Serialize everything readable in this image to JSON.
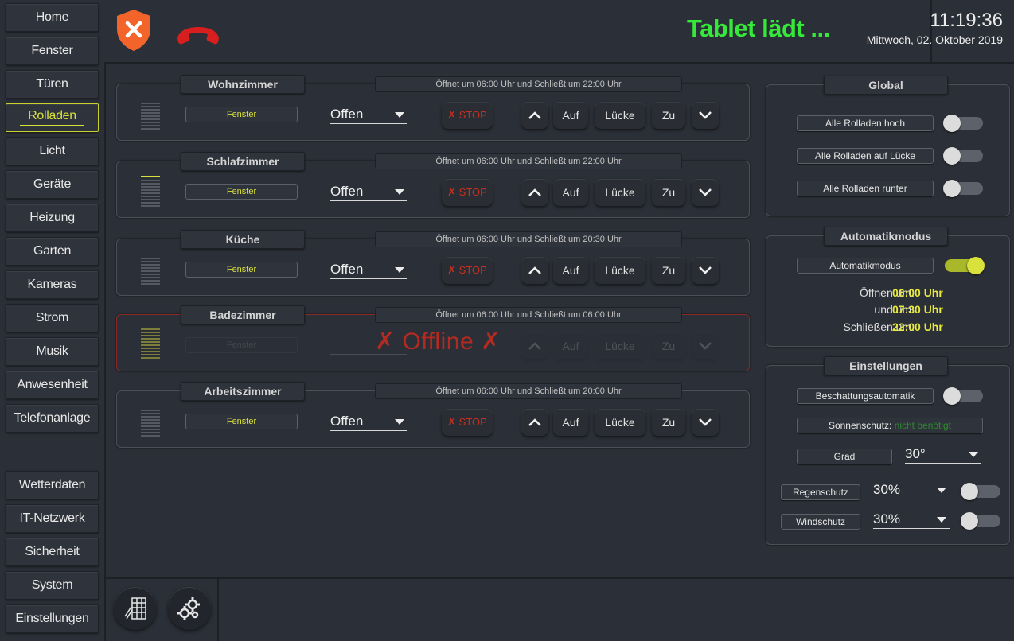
{
  "nav": {
    "items": [
      "Home",
      "Fenster",
      "Türen",
      "Rolladen",
      "Licht",
      "Geräte",
      "Heizung",
      "Garten",
      "Kameras",
      "Strom",
      "Musik",
      "Anwesenheit",
      "Telefonanlage"
    ],
    "bottom_items": [
      "Wetterdaten",
      "IT-Netzwerk",
      "Sicherheit",
      "System",
      "Einstellungen"
    ],
    "active": "Rolladen"
  },
  "header": {
    "status": "Tablet lädt ...",
    "time": "11:19:36",
    "date": "Mittwoch, 02. Oktober 2019",
    "shield_icon": "security-alert-shield-icon",
    "phone_icon": "hangup-phone-icon"
  },
  "rooms": [
    {
      "name": "Wohnzimmer",
      "schedule": "Öffnet um 06:00 Uhr und Schließt um 22:00 Uhr",
      "window": "Fenster",
      "state": "Offen",
      "stop": "✗ STOP",
      "up": "Auf",
      "gap": "Lücke",
      "down": "Zu"
    },
    {
      "name": "Schlafzimmer",
      "schedule": "Öffnet um 06:00 Uhr und Schließt um 22:00 Uhr",
      "window": "Fenster",
      "state": "Offen",
      "stop": "✗ STOP",
      "up": "Auf",
      "gap": "Lücke",
      "down": "Zu"
    },
    {
      "name": "Küche",
      "schedule": "Öffnet um 06:00 Uhr und Schließt um 20:30 Uhr",
      "window": "Fenster",
      "state": "Offen",
      "stop": "✗ STOP",
      "up": "Auf",
      "gap": "Lücke",
      "down": "Zu"
    },
    {
      "name": "Badezimmer",
      "schedule": "Öffnet um 06:00 Uhr und Schließt um 06:00 Uhr",
      "window": "Fenster",
      "state": "",
      "stop": "",
      "up": "Auf",
      "gap": "Lücke",
      "down": "Zu",
      "offline": "✗ Offline ✗"
    },
    {
      "name": "Arbeitszimmer",
      "schedule": "Öffnet um 06:00 Uhr und Schließt um 20:00 Uhr",
      "window": "Fenster",
      "state": "Offen",
      "stop": "✗ STOP",
      "up": "Auf",
      "gap": "Lücke",
      "down": "Zu"
    }
  ],
  "global": {
    "title": "Global",
    "all_up": "Alle Rolladen hoch",
    "all_gap": "Alle Rolladen auf Lücke",
    "all_down": "Alle Rolladen runter"
  },
  "auto": {
    "title": "Automatikmodus",
    "toggle_label": "Automatikmodus",
    "open_label": "Öffnen um:",
    "open_time": "06:00 Uhr",
    "and_label": "und um:",
    "and_time": "07:30 Uhr",
    "close_label": "Schließen um:",
    "close_time": "22:00 Uhr"
  },
  "settings": {
    "title": "Einstellungen",
    "shade_auto": "Beschattungsautomatik",
    "sun_label": "Sonnenschutz:",
    "sun_status": "nicht benötigt",
    "degree_label": "Grad",
    "degree_value": "30°",
    "rain_label": "Regenschutz",
    "rain_value": "30%",
    "wind_label": "Windschutz",
    "wind_value": "30%"
  },
  "colors": {
    "accent": "#d9e23a",
    "status_green": "#35e83a",
    "alert_red": "#c4301f",
    "background": "#2b2f37"
  }
}
